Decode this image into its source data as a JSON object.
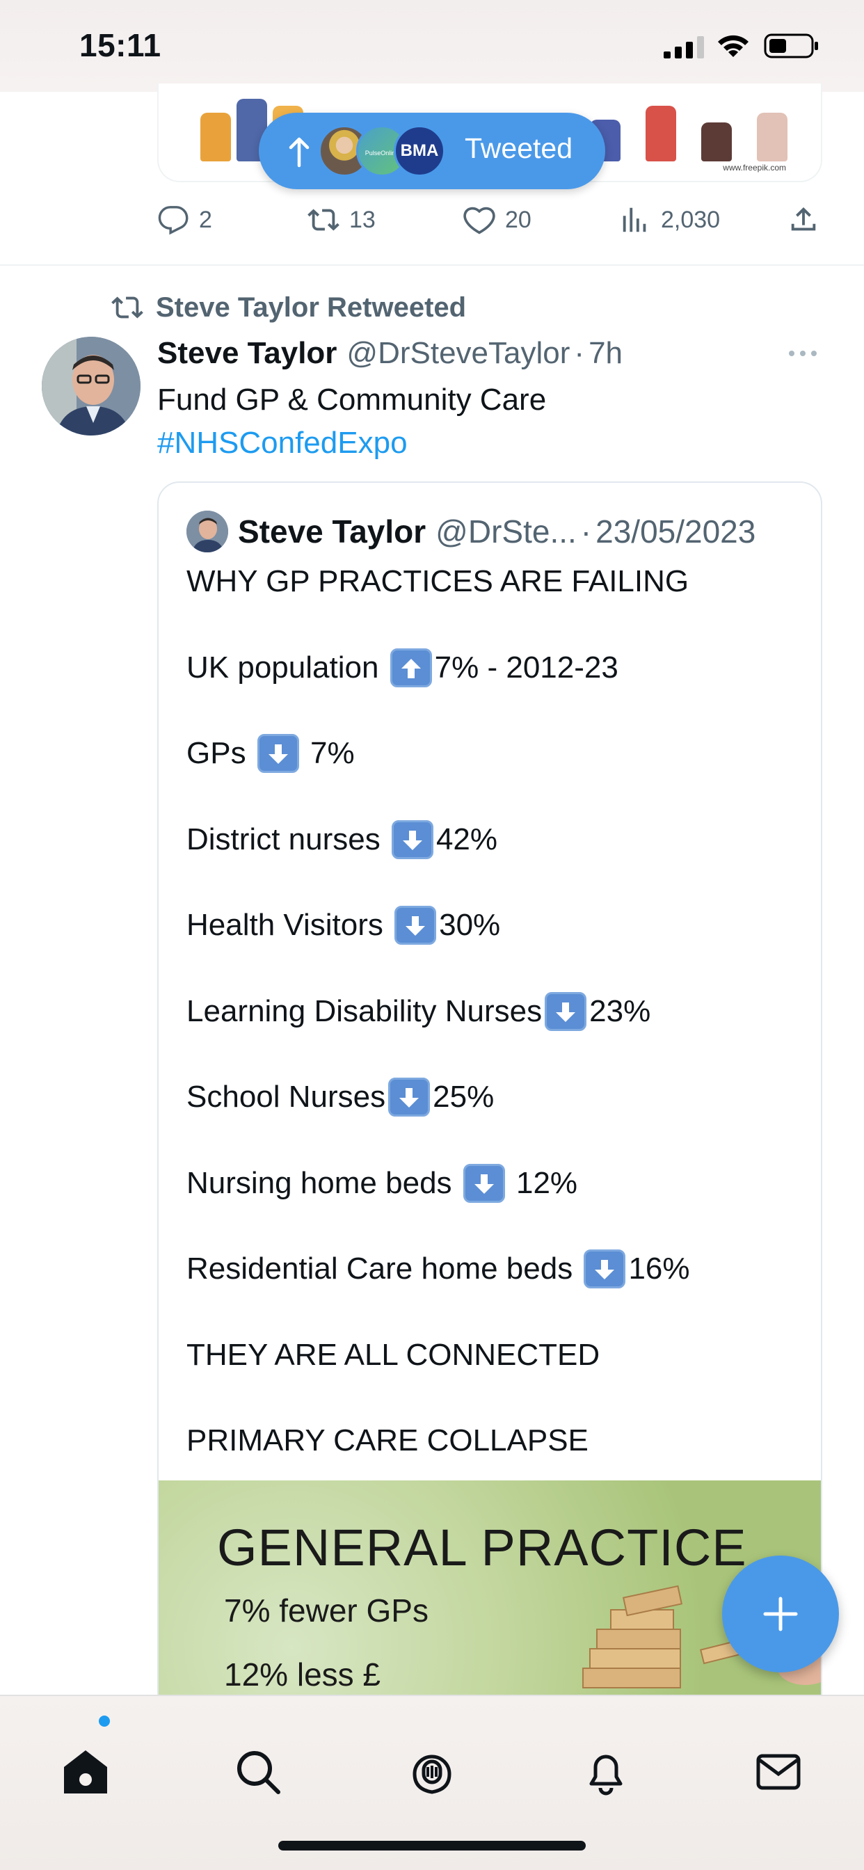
{
  "status_bar": {
    "time": "15:11",
    "icons": [
      "signal-icon",
      "wifi-icon",
      "battery-icon"
    ]
  },
  "tweeted_pill": {
    "label": "Tweeted",
    "avatars": [
      "user-avatar",
      "pulse-online-avatar",
      "bma-avatar"
    ],
    "bma_text": "BMA",
    "pulse_text": "PulseOnline"
  },
  "top_tweet": {
    "media_watermark": "www.freepik.com",
    "actions": {
      "replies": "2",
      "retweets": "13",
      "likes": "20",
      "views": "2,030"
    }
  },
  "tweet": {
    "retweeted_by": "Steve Taylor Retweeted",
    "author": "Steve Taylor",
    "handle": "@DrSteveTaylor",
    "separator": "·",
    "time": "7h",
    "text": "Fund GP & Community Care",
    "hashtag": "#NHSConfedExpo"
  },
  "quote": {
    "author": "Steve Taylor",
    "handle": "@DrSte...",
    "separator": "·",
    "date": "23/05/2023",
    "lines": [
      {
        "before": "WHY GP PRACTICES ARE FAILING",
        "arrow": "",
        "after": ""
      },
      {
        "before": "UK population ",
        "arrow": "up",
        "after": "7% - 2012-23"
      },
      {
        "before": "GPs ",
        "arrow": "down",
        "after": " 7%"
      },
      {
        "before": "District nurses ",
        "arrow": "down",
        "after": "42%"
      },
      {
        "before": "Health Visitors ",
        "arrow": "down",
        "after": "30%"
      },
      {
        "before": "Learning Disability Nurses",
        "arrow": "down",
        "after": "23%"
      },
      {
        "before": "School Nurses",
        "arrow": "down",
        "after": "25%"
      },
      {
        "before": "Nursing home beds ",
        "arrow": "down",
        "after": " 12%"
      },
      {
        "before": "Residential Care home beds ",
        "arrow": "down",
        "after": "16%"
      },
      {
        "before": "THEY ARE ALL CONNECTED",
        "arrow": "",
        "after": ""
      },
      {
        "before": "PRIMARY CARE COLLAPSE",
        "arrow": "",
        "after": ""
      }
    ],
    "image": {
      "title": "GENERAL PRACTICE",
      "line1": "7% fewer GPs",
      "line2": "12% less £"
    }
  },
  "fab": {
    "icon": "plus-icon"
  },
  "tabbar": {
    "items": [
      "home-icon",
      "search-icon",
      "spaces-icon",
      "notifications-icon",
      "messages-icon"
    ]
  },
  "colors": {
    "accent": "#1d9bf0",
    "pill": "#4a99e9",
    "secondary_text": "#536471",
    "arrow_box": "#5b8ed4"
  }
}
